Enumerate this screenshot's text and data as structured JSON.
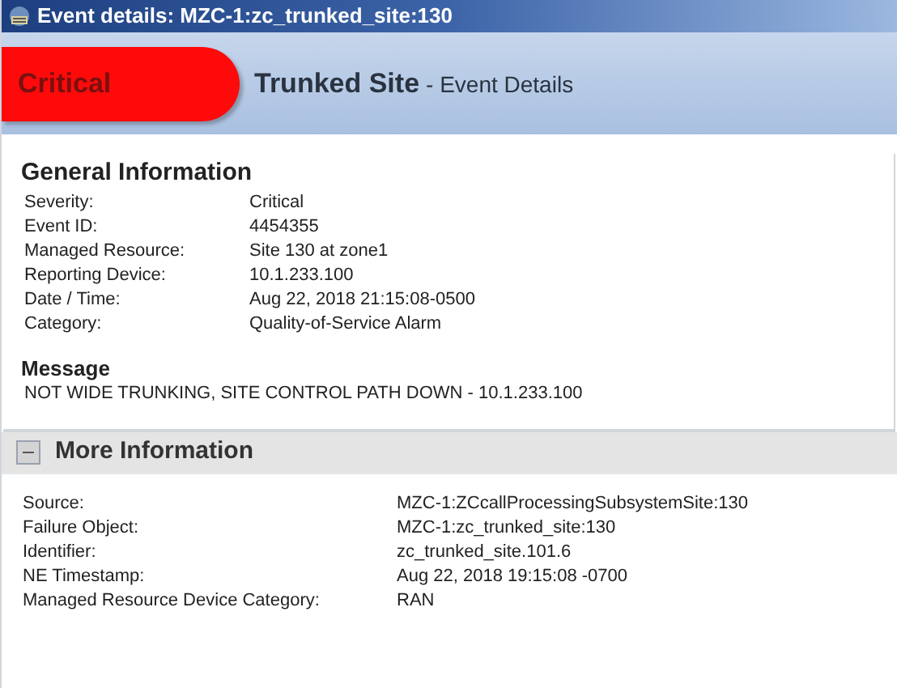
{
  "window": {
    "title": "Event details: MZC-1:zc_trunked_site:130"
  },
  "header": {
    "severity": "Critical",
    "title": "Trunked Site",
    "subtitle": "- Event Details"
  },
  "general_information": {
    "heading": "General Information",
    "rows": [
      {
        "label": "Severity:",
        "value": "Critical"
      },
      {
        "label": "Event ID:",
        "value": "4454355"
      },
      {
        "label": "Managed Resource:",
        "value": "Site 130 at zone1"
      },
      {
        "label": "Reporting Device:",
        "value": "10.1.233.100"
      },
      {
        "label": "Date / Time:",
        "value": "Aug 22, 2018 21:15:08-0500"
      },
      {
        "label": "Category:",
        "value": "Quality-of-Service Alarm"
      }
    ],
    "message_heading": "Message",
    "message": "NOT WIDE TRUNKING, SITE CONTROL PATH DOWN - 10.1.233.100"
  },
  "more_information": {
    "heading": "More Information",
    "expanded": true,
    "rows": [
      {
        "label": "Source:",
        "value": "MZC-1:ZCcallProcessingSubsystemSite:130"
      },
      {
        "label": "Failure Object:",
        "value": "MZC-1:zc_trunked_site:130"
      },
      {
        "label": "Identifier:",
        "value": "zc_trunked_site.101.6"
      },
      {
        "label": "NE Timestamp:",
        "value": "Aug 22, 2018 19:15:08 -0700"
      },
      {
        "label": "Managed Resource Device Category:",
        "value": "RAN"
      }
    ]
  }
}
